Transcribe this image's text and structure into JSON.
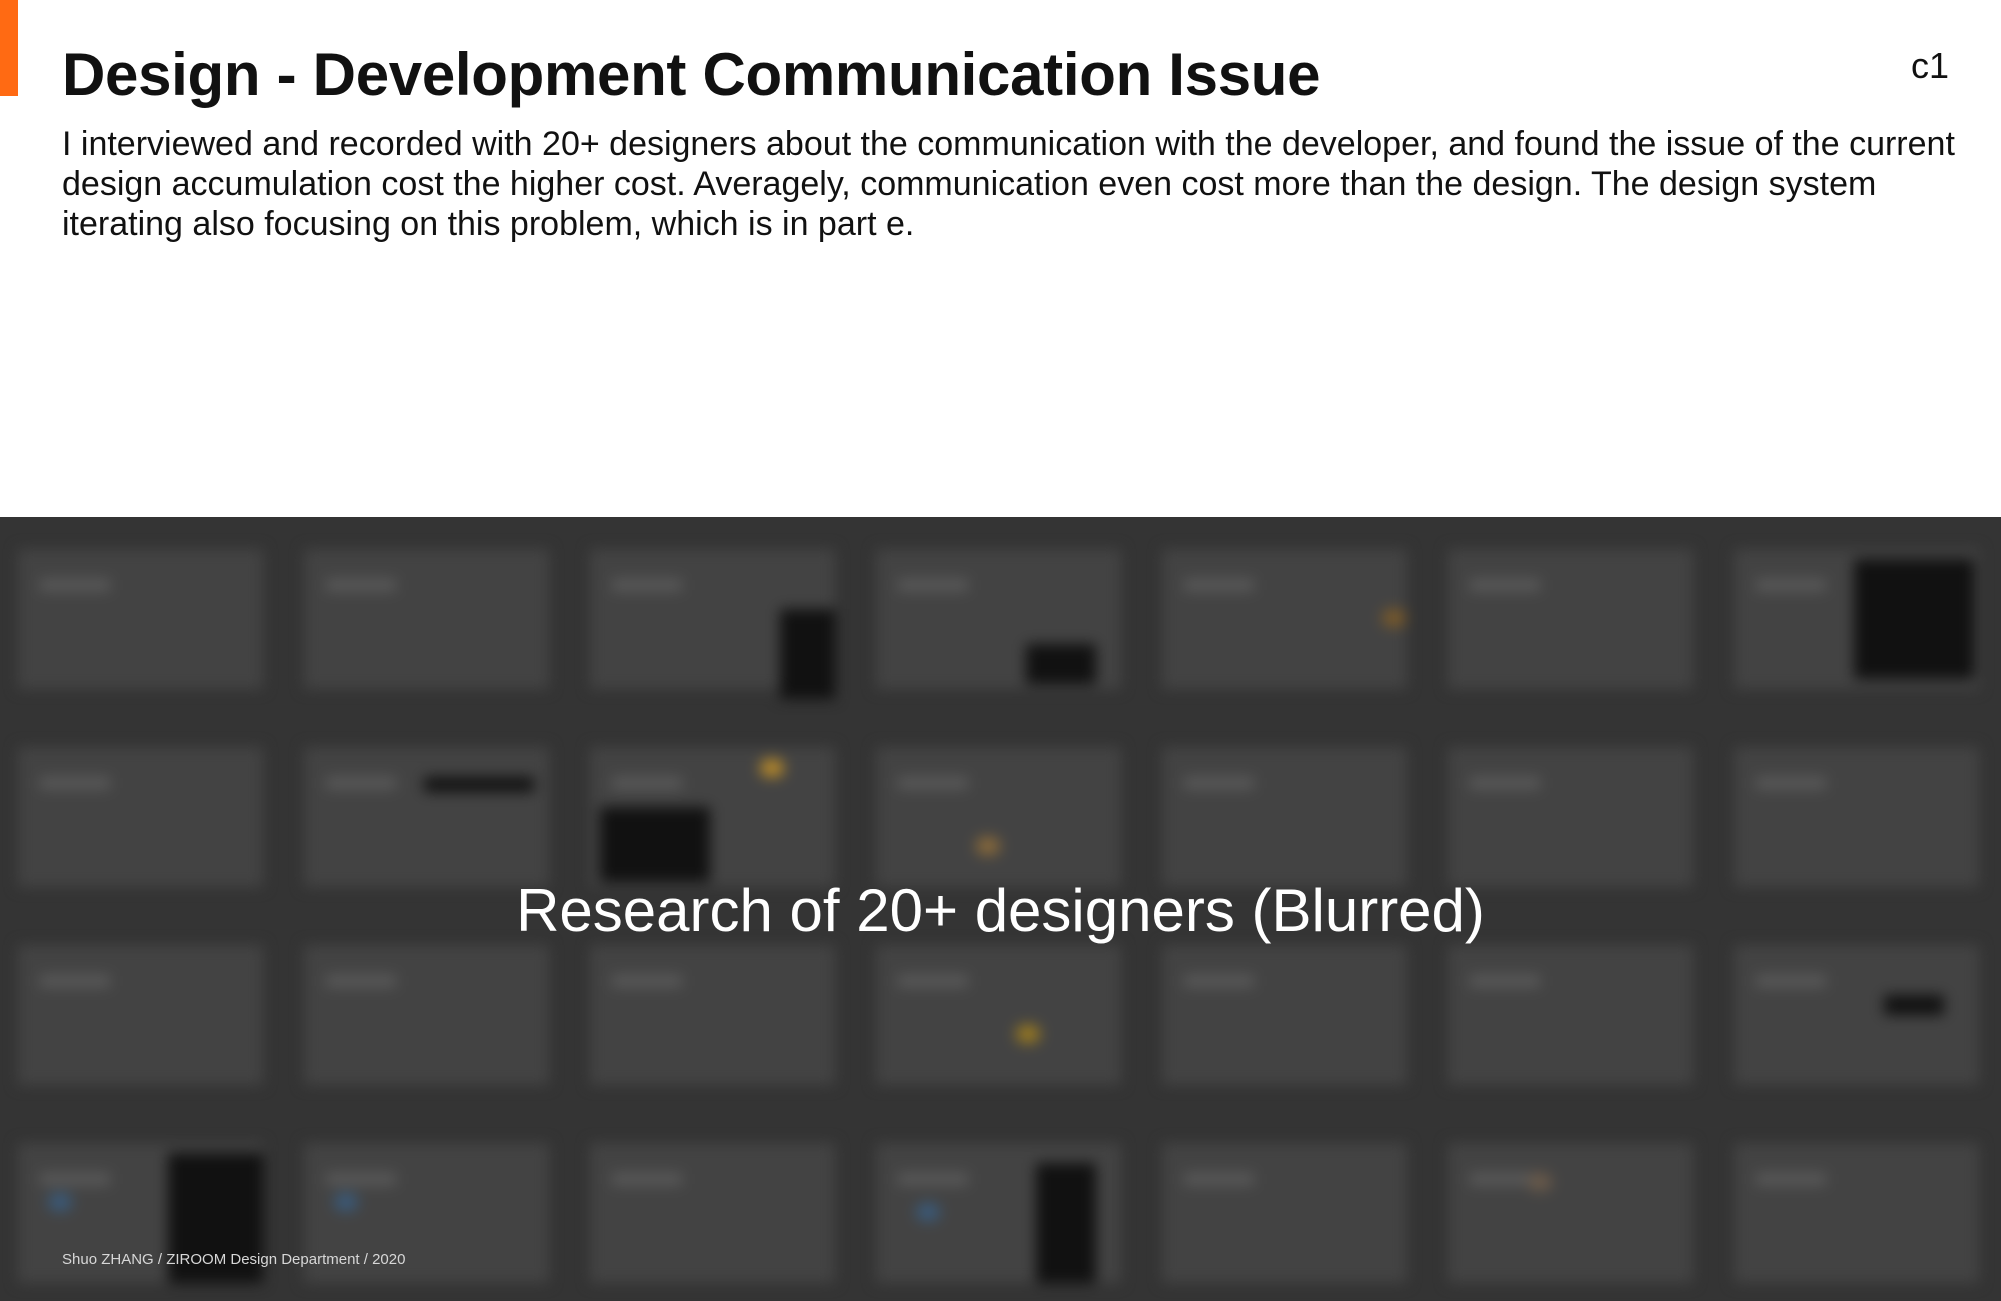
{
  "header": {
    "title": "Design - Development Communication Issue",
    "page_code": "c1",
    "accent_color": "#ff6a13"
  },
  "intro": {
    "text": "I interviewed and recorded with 20+ designers about the communication with the developer, and found the issue of the current design accumulation cost the higher cost. Averagely, communication even cost more than the design. The design system iterating also focusing on this problem, which is in part e."
  },
  "research_image": {
    "caption": "Research of 20+ designers (Blurred)",
    "footer_credit": "Shuo ZHANG / ZIROOM Design Department / 2020",
    "panel_color": "#343434"
  }
}
